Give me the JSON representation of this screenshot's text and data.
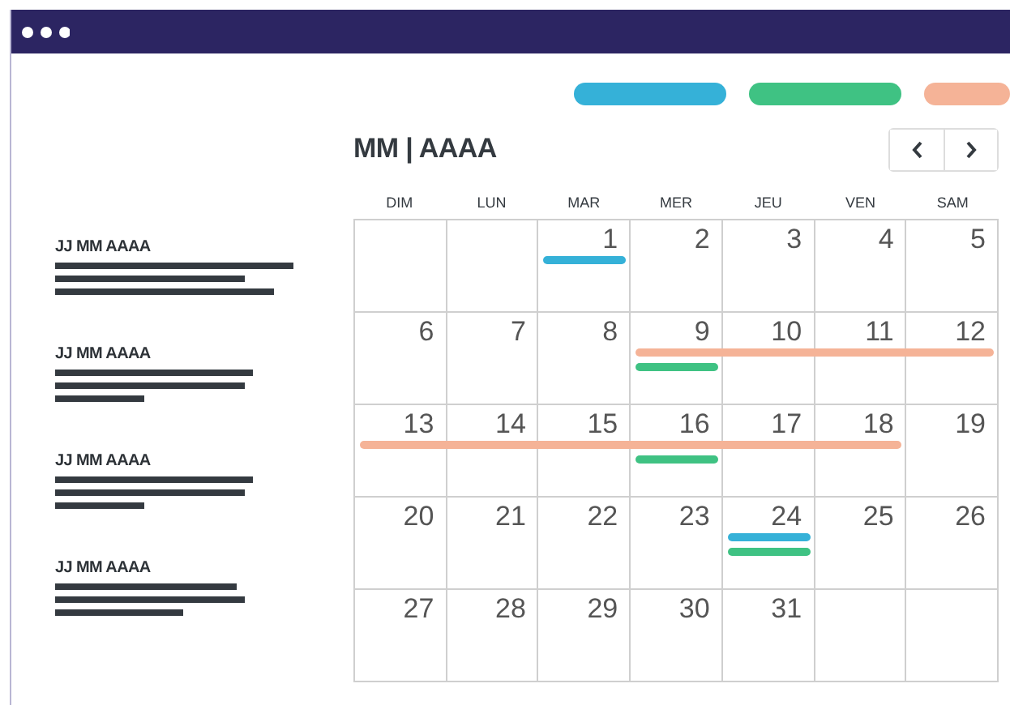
{
  "legend": [
    {
      "color": "#35b1d8"
    },
    {
      "color": "#3fc283"
    },
    {
      "color": "#f5b397"
    }
  ],
  "header": {
    "title": "MM | AAAA"
  },
  "weekdays": [
    "DIM",
    "LUN",
    "MAR",
    "MER",
    "JEU",
    "VEN",
    "SAM"
  ],
  "agenda": [
    {
      "date": "JJ MM AAAA"
    },
    {
      "date": "JJ MM AAAA"
    },
    {
      "date": "JJ MM AAAA"
    },
    {
      "date": "JJ MM AAAA"
    }
  ],
  "weeks": [
    {
      "days": [
        {
          "kind": "blank"
        },
        {
          "kind": "blank"
        },
        {
          "kind": "date",
          "number": "1",
          "events": [
            {
              "color": "#35b1d8"
            }
          ]
        },
        {
          "kind": "date",
          "number": "2"
        },
        {
          "kind": "date",
          "number": "3"
        },
        {
          "kind": "date",
          "number": "4"
        },
        {
          "kind": "date",
          "number": "5"
        }
      ]
    },
    {
      "days": [
        {
          "kind": "date",
          "number": "6"
        },
        {
          "kind": "date",
          "number": "7"
        },
        {
          "kind": "date",
          "number": "8"
        },
        {
          "kind": "date",
          "number": "9",
          "events": [
            {
              "color": "#f5b397"
            },
            {
              "color": "#3fc283"
            }
          ]
        },
        {
          "kind": "date",
          "number": "10",
          "events": [
            {
              "color": "#f5b397"
            }
          ]
        },
        {
          "kind": "date",
          "number": "11",
          "events": [
            {
              "color": "#f5b397"
            }
          ]
        },
        {
          "kind": "date",
          "number": "12",
          "events": [
            {
              "color": "#f5b397"
            }
          ]
        }
      ]
    },
    {
      "days": [
        {
          "kind": "date",
          "number": "13",
          "events": [
            {
              "color": "#f5b397"
            }
          ]
        },
        {
          "kind": "date",
          "number": "14",
          "events": [
            {
              "color": "#f5b397"
            }
          ]
        },
        {
          "kind": "date",
          "number": "15",
          "events": [
            {
              "color": "#f5b397"
            }
          ]
        },
        {
          "kind": "date",
          "number": "16",
          "events": [
            {
              "color": "#f5b397"
            },
            {
              "color": "#3fc283"
            }
          ]
        },
        {
          "kind": "date",
          "number": "17",
          "events": [
            {
              "color": "#f5b397"
            }
          ]
        },
        {
          "kind": "date",
          "number": "18",
          "events": [
            {
              "color": "#f5b397"
            }
          ]
        },
        {
          "kind": "date",
          "number": "19"
        }
      ]
    },
    {
      "days": [
        {
          "kind": "date",
          "number": "20"
        },
        {
          "kind": "date",
          "number": "21"
        },
        {
          "kind": "date",
          "number": "22"
        },
        {
          "kind": "date",
          "number": "23"
        },
        {
          "kind": "date",
          "number": "24",
          "events": [
            {
              "color": "#35b1d8"
            },
            {
              "color": "#3fc283"
            }
          ]
        },
        {
          "kind": "date",
          "number": "25"
        },
        {
          "kind": "date",
          "number": "26"
        }
      ]
    },
    {
      "days": [
        {
          "kind": "date",
          "number": "27"
        },
        {
          "kind": "date",
          "number": "28"
        },
        {
          "kind": "date",
          "number": "29"
        },
        {
          "kind": "date",
          "number": "30"
        },
        {
          "kind": "date",
          "number": "31"
        },
        {
          "kind": "blank"
        },
        {
          "kind": "blank"
        }
      ]
    }
  ]
}
